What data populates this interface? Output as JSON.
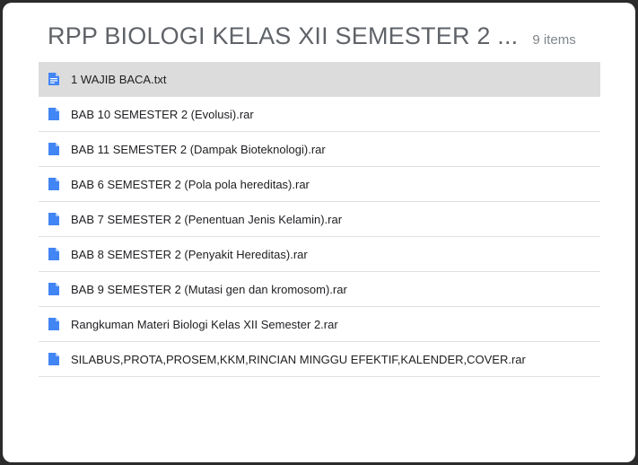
{
  "folder": {
    "title": "RPP BIOLOGI KELAS XII SEMESTER 2 ...",
    "item_count": "9 items"
  },
  "files": [
    {
      "name": "1 WAJIB BACA.txt",
      "icon": "text-document-icon",
      "selected": true
    },
    {
      "name": "BAB 10 SEMESTER 2 (Evolusi).rar",
      "icon": "file-icon",
      "selected": false
    },
    {
      "name": "BAB 11 SEMESTER 2 (Dampak Bioteknologi).rar",
      "icon": "file-icon",
      "selected": false
    },
    {
      "name": "BAB 6 SEMESTER 2 (Pola pola hereditas).rar",
      "icon": "file-icon",
      "selected": false
    },
    {
      "name": "BAB 7 SEMESTER 2 (Penentuan Jenis Kelamin).rar",
      "icon": "file-icon",
      "selected": false
    },
    {
      "name": "BAB 8 SEMESTER 2 (Penyakit Hereditas).rar",
      "icon": "file-icon",
      "selected": false
    },
    {
      "name": "BAB 9 SEMESTER 2 (Mutasi gen dan kromosom).rar",
      "icon": "file-icon",
      "selected": false
    },
    {
      "name": "Rangkuman Materi Biologi Kelas XII Semester 2.rar",
      "icon": "file-icon",
      "selected": false
    },
    {
      "name": "SILABUS,PROTA,PROSEM,KKM,RINCIAN MINGGU EFEKTIF,KALENDER,COVER.rar",
      "icon": "file-icon",
      "selected": false
    }
  ],
  "colors": {
    "icon_blue": "#4285f4",
    "selected_row": "#dcdcdc"
  }
}
